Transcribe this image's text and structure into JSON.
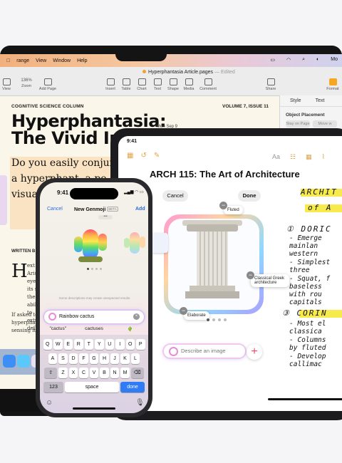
{
  "mac": {
    "menu": [
      "range",
      "View",
      "Window",
      "Help"
    ],
    "menu_right": [
      "Mo"
    ],
    "doc_title": "Hyperphantasia Article.pages",
    "doc_status": "— Edited",
    "toolbar": [
      {
        "label": "View"
      },
      {
        "label": "Zoom"
      },
      {
        "label": "Add Page"
      },
      {
        "label": "Insert"
      },
      {
        "label": "Table"
      },
      {
        "label": "Chart"
      },
      {
        "label": "Text"
      },
      {
        "label": "Shape"
      },
      {
        "label": "Media"
      },
      {
        "label": "Comment"
      },
      {
        "label": "Share"
      },
      {
        "label": "Format"
      }
    ],
    "zoom": "136%",
    "side_tabs": [
      "Style",
      "Text"
    ],
    "side_section": "Object Placement",
    "side_options": [
      "Stay on Page",
      "Move w"
    ],
    "column_head": "COGNITIVE SCIENCE COLUMN",
    "volume": "VOLUME 7, ISSUE 11",
    "title_l1": "Hyperphantasia:",
    "title_l2": "The Vivid Imag",
    "date": "Mon Sep 9",
    "lead": "Do you easily conjure be a hyperphant, a pe visual one's that s",
    "written": "WRITTEN B",
    "dropcap": "H",
    "body1": "ext Aristotle's eye,\" its sym the ability to extreme def",
    "body2": "If asked to hyperphan sensing its"
  },
  "ipad": {
    "time": "9:41",
    "note_title": "ARCH 115: The Art of Architecture",
    "cancel": "Cancel",
    "done": "Done",
    "aa": "Aa",
    "tags": [
      "Fluted",
      "Classical Greek architecture",
      "Elaborate"
    ],
    "describe_placeholder": "Describe an image",
    "plus": "+",
    "hand_head1": "ARCHIT",
    "hand_of": "of A",
    "hand_lines": [
      "① DORIC",
      "- Emerge",
      "  mainlan",
      "  western",
      "- Simplest",
      "  three",
      "- Squat, f",
      "  baseless",
      "  with rou",
      "  capitals"
    ],
    "hand_head2": "③ CORIN",
    "hand_lines2": [
      "- Most el",
      "  classica",
      "- Columns",
      "  by fluted",
      "- Develop",
      "  callimac"
    ]
  },
  "iphone": {
    "time": "9:41",
    "status": "▂▄▆ ◠ ▭",
    "cancel": "Cancel",
    "title": "New Genmoji",
    "beta": "BETA",
    "add": "Add",
    "warning": "Some descriptions may create unexpected results.",
    "input_value": "Rainbow cactus",
    "suggestions": [
      "\"cactus\"",
      "cactuses",
      "🌵"
    ],
    "keys_row1": [
      "Q",
      "W",
      "E",
      "R",
      "T",
      "Y",
      "U",
      "I",
      "O",
      "P"
    ],
    "keys_row2": [
      "A",
      "S",
      "D",
      "F",
      "G",
      "H",
      "J",
      "K",
      "L"
    ],
    "keys_row3": [
      "Z",
      "X",
      "C",
      "V",
      "B",
      "N",
      "M"
    ],
    "key_123": "123",
    "key_space": "space",
    "key_done": "done"
  }
}
